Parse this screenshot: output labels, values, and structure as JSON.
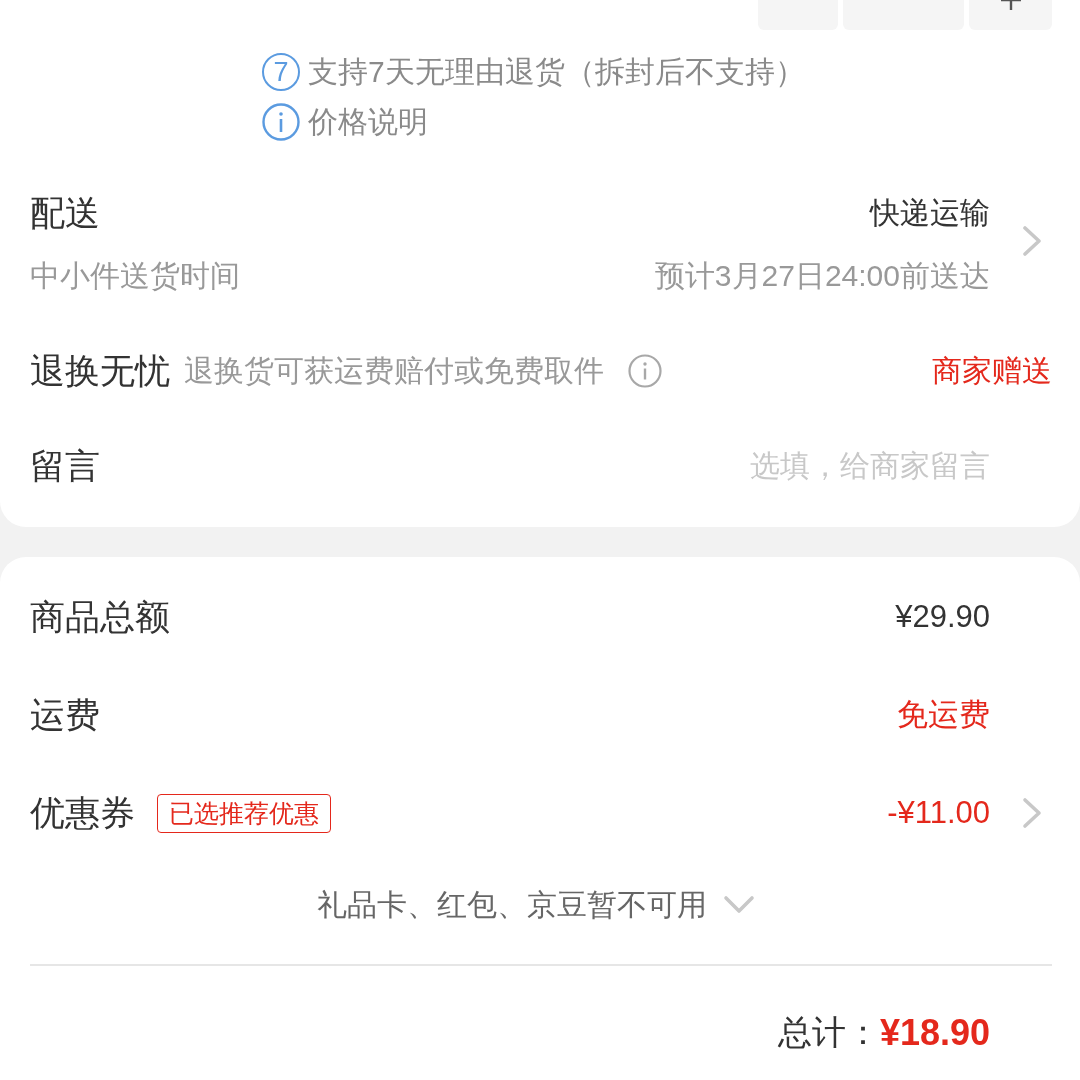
{
  "services": [
    {
      "kind": "days",
      "badge": "7",
      "text": "支持7天无理由退货（拆封后不支持）"
    },
    {
      "kind": "info",
      "text": "价格说明"
    }
  ],
  "delivery": {
    "label": "配送",
    "method": "快递运输",
    "sub_label": "中小件送货时间",
    "estimate": "预计3月27日24:00前送达"
  },
  "returns": {
    "label": "退换无忧",
    "description": "退换货可获运费赔付或免费取件",
    "value": "商家赠送"
  },
  "message": {
    "label": "留言",
    "placeholder": "选填，给商家留言"
  },
  "summary": {
    "rows": [
      {
        "kind": "plain",
        "label": "商品总额",
        "value": "¥29.90",
        "highlight": false
      },
      {
        "kind": "plain",
        "label": "运费",
        "value": "免运费",
        "highlight": true
      },
      {
        "kind": "coupon",
        "label": "优惠券",
        "tag": "已选推荐优惠",
        "value": "-¥11.00",
        "highlight": true
      }
    ],
    "unavailable": {
      "text": "礼品卡、红包、京豆暂不可用",
      "expanded": false
    },
    "total": {
      "label": "总计：",
      "amount": "¥18.90"
    }
  }
}
